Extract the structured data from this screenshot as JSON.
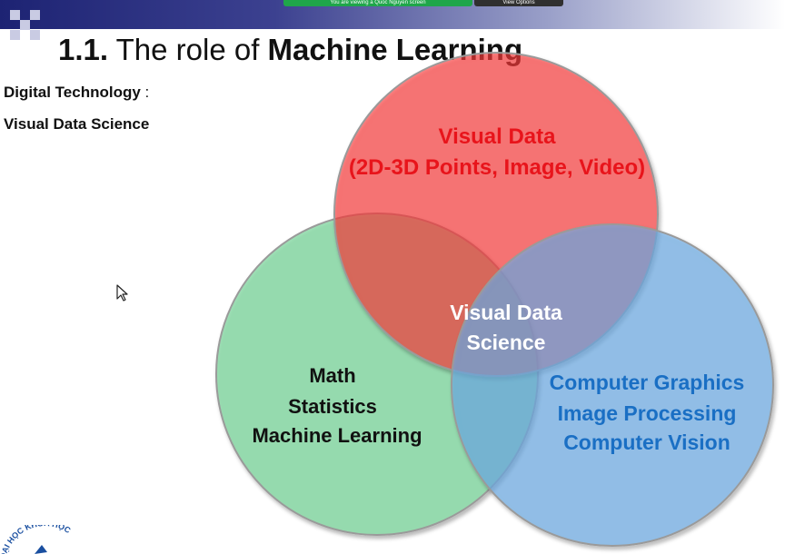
{
  "screen_share": {
    "banner_text": "You are viewing a Quoc Nguyen screen",
    "button_label": "View Options"
  },
  "slide": {
    "title_number": "1.1.",
    "title_text": "The role of",
    "title_bold": "Machine Learning",
    "side_line_1_bold": "Digital Technology",
    "side_line_1_suffix": " :",
    "side_line_2": "Visual Data Science"
  },
  "venn": {
    "top": {
      "line1": "Visual Data",
      "line2": "(2D-3D Points, Image, Video)",
      "color": "#ff3b3b",
      "text_color": "#e8141b"
    },
    "left": {
      "line1": "Math",
      "line2": "Statistics",
      "line3": "Machine Learning",
      "color": "#7fd8a0",
      "text_color": "#111111"
    },
    "right": {
      "line1": "Computer Graphics",
      "line2": "Image Processing",
      "line3": "Computer Vision",
      "color": "#6faee8",
      "text_color": "#1a6fc4"
    },
    "center": {
      "line1": "Visual Data",
      "line2": "Science",
      "text_color": "#ffffff"
    }
  },
  "logo": {
    "text": "ĐẠI HỌC KHOA HỌC"
  },
  "icons": {
    "cursor": "mouse-pointer-icon"
  }
}
